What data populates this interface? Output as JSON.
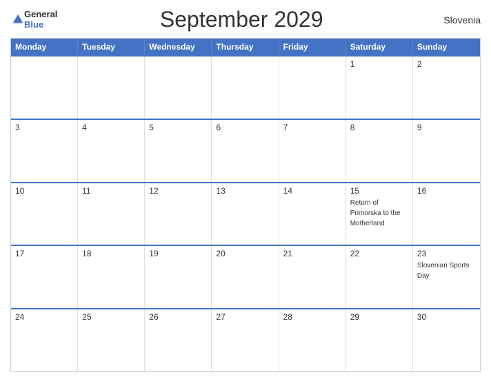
{
  "header": {
    "logo_general": "General",
    "logo_blue": "Blue",
    "title": "September 2029",
    "country": "Slovenia"
  },
  "weekdays": [
    "Monday",
    "Tuesday",
    "Wednesday",
    "Thursday",
    "Friday",
    "Saturday",
    "Sunday"
  ],
  "rows": [
    [
      {
        "day": "",
        "event": ""
      },
      {
        "day": "",
        "event": ""
      },
      {
        "day": "",
        "event": ""
      },
      {
        "day": "",
        "event": ""
      },
      {
        "day": "",
        "event": ""
      },
      {
        "day": "1",
        "event": ""
      },
      {
        "day": "2",
        "event": ""
      }
    ],
    [
      {
        "day": "3",
        "event": ""
      },
      {
        "day": "4",
        "event": ""
      },
      {
        "day": "5",
        "event": ""
      },
      {
        "day": "6",
        "event": ""
      },
      {
        "day": "7",
        "event": ""
      },
      {
        "day": "8",
        "event": ""
      },
      {
        "day": "9",
        "event": ""
      }
    ],
    [
      {
        "day": "10",
        "event": ""
      },
      {
        "day": "11",
        "event": ""
      },
      {
        "day": "12",
        "event": ""
      },
      {
        "day": "13",
        "event": ""
      },
      {
        "day": "14",
        "event": ""
      },
      {
        "day": "15",
        "event": "Return of Primorska to the Motherland"
      },
      {
        "day": "16",
        "event": ""
      }
    ],
    [
      {
        "day": "17",
        "event": ""
      },
      {
        "day": "18",
        "event": ""
      },
      {
        "day": "19",
        "event": ""
      },
      {
        "day": "20",
        "event": ""
      },
      {
        "day": "21",
        "event": ""
      },
      {
        "day": "22",
        "event": ""
      },
      {
        "day": "23",
        "event": "Slovenian Sports Day"
      }
    ],
    [
      {
        "day": "24",
        "event": ""
      },
      {
        "day": "25",
        "event": ""
      },
      {
        "day": "26",
        "event": ""
      },
      {
        "day": "27",
        "event": ""
      },
      {
        "day": "28",
        "event": ""
      },
      {
        "day": "29",
        "event": ""
      },
      {
        "day": "30",
        "event": ""
      }
    ]
  ]
}
